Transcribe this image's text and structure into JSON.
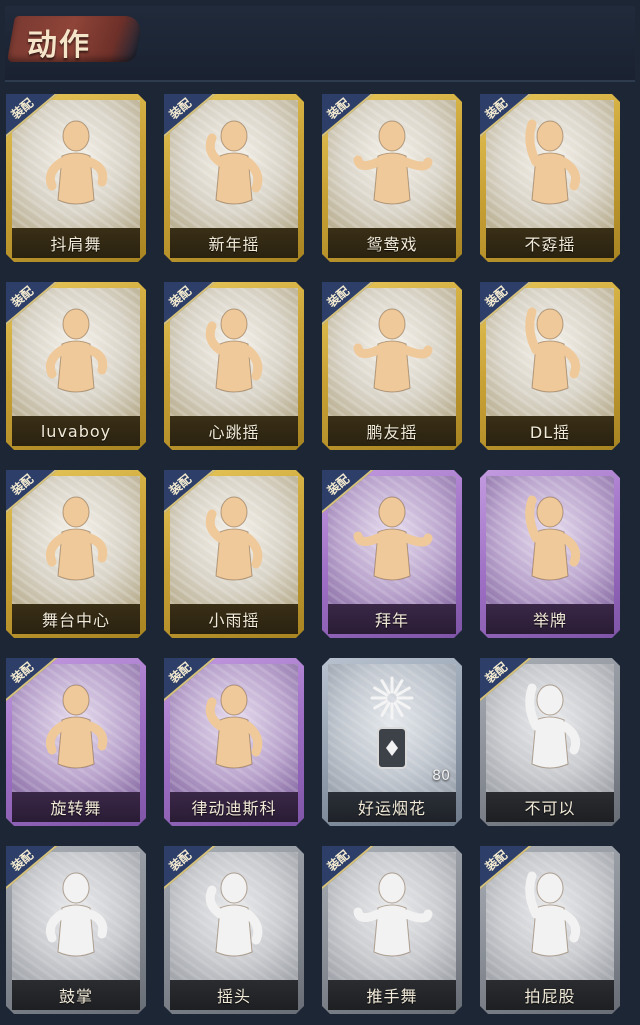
{
  "header": {
    "title": "动作"
  },
  "equip_label": "装配",
  "colors": {
    "background": "#1d2635",
    "gold_frame": "#c9a236",
    "purple_frame": "#9e6fc4",
    "silver_frame": "#8e9aaa",
    "grey_frame": "#878c94",
    "equip_badge": "#2d3f69",
    "figure_gold": "#efc99a",
    "figure_pale": "#f2f2f2"
  },
  "emotes": [
    {
      "label": "抖肩舞",
      "tier": "gold",
      "equipped": true,
      "icon": "shoulder-shake-icon"
    },
    {
      "label": "新年摇",
      "tier": "gold",
      "equipped": true,
      "icon": "new-year-sway-icon"
    },
    {
      "label": "鸳鸯戏",
      "tier": "gold",
      "equipped": true,
      "icon": "mandarin-duck-icon"
    },
    {
      "label": "不孬摇",
      "tier": "gold",
      "equipped": true,
      "icon": "arm-raise-sway-icon"
    },
    {
      "label": "luvaboy",
      "tier": "gold",
      "equipped": true,
      "icon": "luvaboy-dance-icon"
    },
    {
      "label": "心跳摇",
      "tier": "gold",
      "equipped": true,
      "icon": "heartbeat-sway-icon"
    },
    {
      "label": "鹏友摇",
      "tier": "gold",
      "equipped": true,
      "icon": "friend-sway-icon"
    },
    {
      "label": "DL摇",
      "tier": "gold",
      "equipped": true,
      "icon": "dl-sway-icon"
    },
    {
      "label": "舞台中心",
      "tier": "gold",
      "equipped": true,
      "icon": "center-stage-icon"
    },
    {
      "label": "小雨摇",
      "tier": "gold",
      "equipped": true,
      "icon": "light-rain-sway-icon"
    },
    {
      "label": "拜年",
      "tier": "purple",
      "equipped": true,
      "icon": "new-year-greeting-icon"
    },
    {
      "label": "举牌",
      "tier": "purple",
      "equipped": false,
      "icon": "hold-sign-icon"
    },
    {
      "label": "旋转舞",
      "tier": "purple",
      "equipped": true,
      "icon": "spin-dance-icon"
    },
    {
      "label": "律动迪斯科",
      "tier": "purple",
      "equipped": true,
      "icon": "disco-icon"
    },
    {
      "label": "好运烟花",
      "tier": "silver",
      "equipped": false,
      "icon": "firework-icon",
      "count": "80"
    },
    {
      "label": "不可以",
      "tier": "grey",
      "equipped": true,
      "icon": "finger-wag-icon"
    },
    {
      "label": "鼓掌",
      "tier": "grey",
      "equipped": true,
      "icon": "clap-icon"
    },
    {
      "label": "摇头",
      "tier": "grey",
      "equipped": true,
      "icon": "head-shake-icon"
    },
    {
      "label": "推手舞",
      "tier": "grey",
      "equipped": true,
      "icon": "push-hands-dance-icon"
    },
    {
      "label": "拍屁股",
      "tier": "grey",
      "equipped": true,
      "icon": "butt-slap-icon"
    }
  ]
}
